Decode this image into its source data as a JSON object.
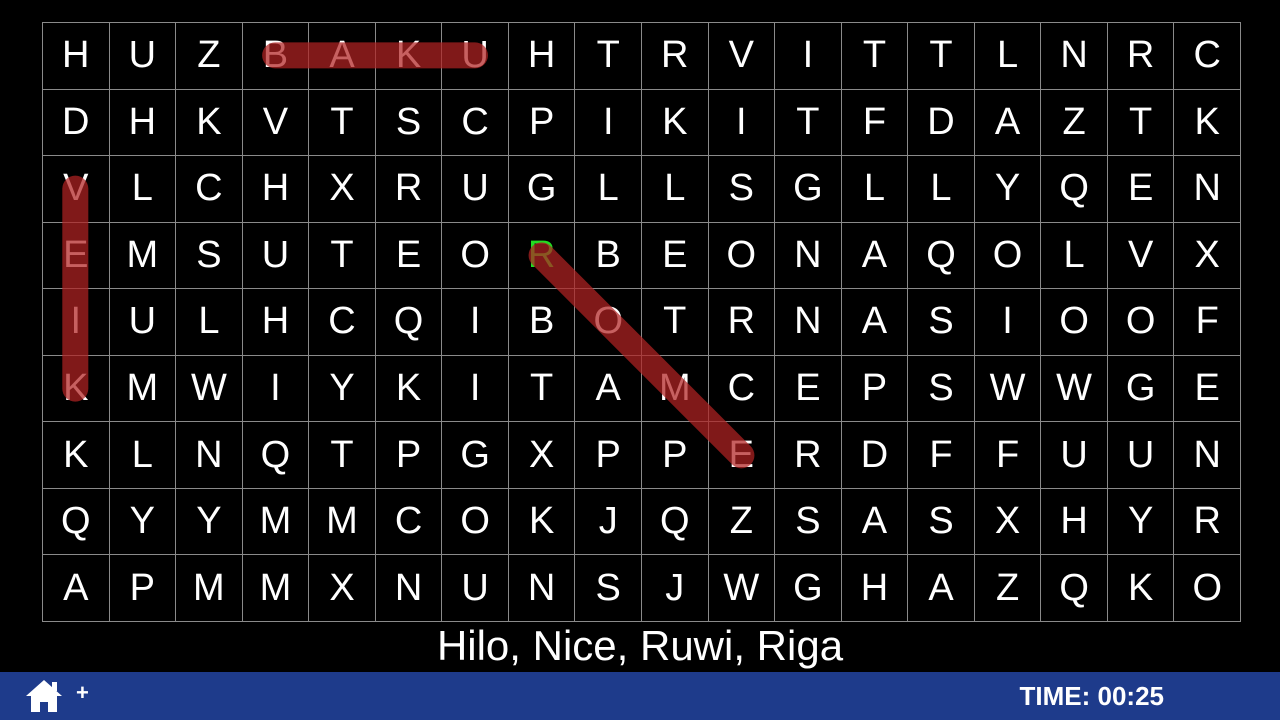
{
  "grid": {
    "rows": [
      [
        "H",
        "U",
        "Z",
        "B",
        "A",
        "K",
        "U",
        "H",
        "T",
        "R",
        "V",
        "I",
        "T",
        "T",
        "L",
        "N",
        "R",
        "C"
      ],
      [
        "D",
        "H",
        "K",
        "V",
        "T",
        "S",
        "C",
        "P",
        "I",
        "K",
        "I",
        "T",
        "F",
        "D",
        "A",
        "Z",
        "T",
        "K"
      ],
      [
        "V",
        "L",
        "C",
        "H",
        "X",
        "R",
        "U",
        "G",
        "L",
        "L",
        "S",
        "G",
        "L",
        "L",
        "Y",
        "Q",
        "E",
        "N"
      ],
      [
        "E",
        "M",
        "S",
        "U",
        "T",
        "E",
        "O",
        "R",
        "B",
        "E",
        "O",
        "N",
        "A",
        "Q",
        "O",
        "L",
        "V",
        "X"
      ],
      [
        "I",
        "U",
        "L",
        "H",
        "C",
        "Q",
        "I",
        "B",
        "O",
        "T",
        "R",
        "N",
        "A",
        "S",
        "I",
        "O",
        "O",
        "F"
      ],
      [
        "K",
        "M",
        "W",
        "I",
        "Y",
        "K",
        "I",
        "T",
        "A",
        "M",
        "C",
        "E",
        "P",
        "S",
        "W",
        "W",
        "G",
        "E"
      ],
      [
        "K",
        "L",
        "N",
        "Q",
        "T",
        "P",
        "G",
        "X",
        "P",
        "P",
        "E",
        "R",
        "D",
        "F",
        "F",
        "U",
        "U",
        "N"
      ],
      [
        "Q",
        "Y",
        "Y",
        "M",
        "M",
        "C",
        "O",
        "K",
        "J",
        "Q",
        "Z",
        "S",
        "A",
        "S",
        "X",
        "H",
        "Y",
        "R"
      ],
      [
        "A",
        "P",
        "M",
        "M",
        "X",
        "N",
        "U",
        "N",
        "S",
        "J",
        "W",
        "G",
        "H",
        "A",
        "Z",
        "Q",
        "K",
        "O"
      ]
    ],
    "active_cell": [
      3,
      7
    ],
    "active_color": "#22dd22"
  },
  "found_words": [
    {
      "word": "BAKU",
      "start": [
        0,
        3
      ],
      "end": [
        0,
        6
      ]
    },
    {
      "word": "VEIK",
      "start": [
        2,
        0
      ],
      "end": [
        5,
        0
      ]
    },
    {
      "word": "ROME",
      "start": [
        3,
        7
      ],
      "end": [
        6,
        10
      ]
    }
  ],
  "highlight_color": "#b22222",
  "word_list": "Hilo, Nice, Ruwi, Riga",
  "bottom_bar": {
    "home_icon": "home-icon",
    "add_label": "+",
    "timer": "TIME: 00:25",
    "color": "#1e3b8b"
  }
}
